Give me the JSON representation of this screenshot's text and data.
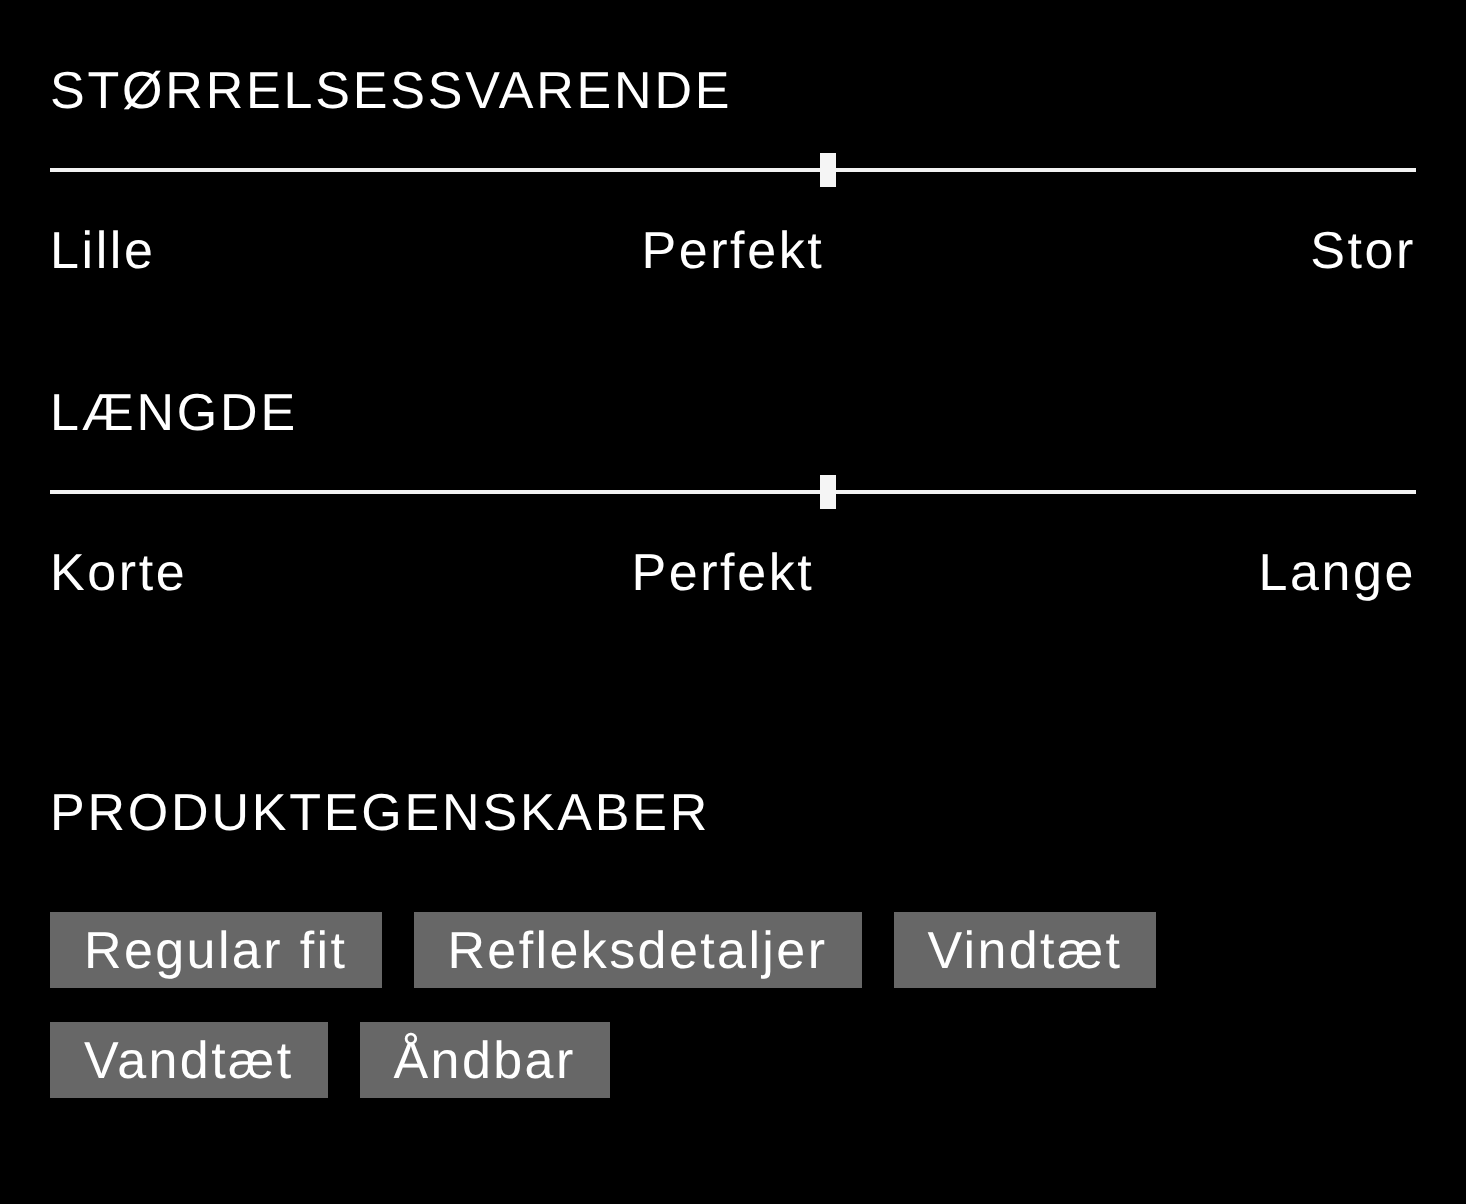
{
  "scales": [
    {
      "title": "STØRRELSESSVARENDE",
      "level": 0.57,
      "labels": [
        "Lille",
        "Perfekt",
        "Stor"
      ]
    },
    {
      "title": "LÆNGDE",
      "level": 0.57,
      "labels": [
        "Korte",
        "Perfekt",
        "Lange"
      ]
    }
  ],
  "features": {
    "title": "PRODUKTEGENSKABER",
    "tags": [
      "Regular fit",
      "Refleksdetaljer",
      "Vindtæt",
      "Vandtæt",
      "Åndbar"
    ]
  }
}
